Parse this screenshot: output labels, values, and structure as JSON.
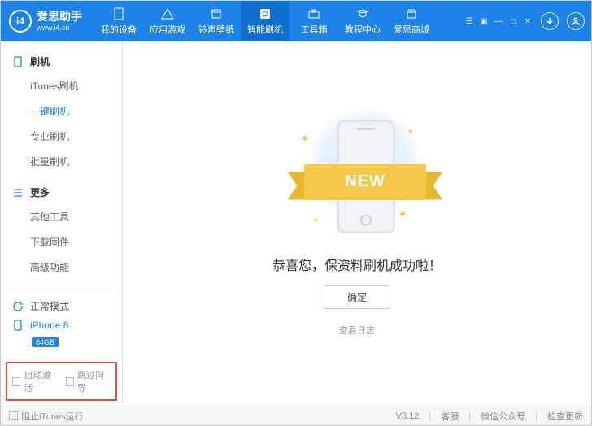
{
  "brand": {
    "logo_text": "i4",
    "title": "爱思助手",
    "url": "www.i4.cn"
  },
  "tabs": [
    {
      "label": "我的设备"
    },
    {
      "label": "应用游戏"
    },
    {
      "label": "铃声壁纸"
    },
    {
      "label": "智能刷机"
    },
    {
      "label": "工具箱"
    },
    {
      "label": "教程中心"
    },
    {
      "label": "爱思商城"
    }
  ],
  "sidebar": {
    "groups": [
      {
        "title": "刷机",
        "items": [
          "iTunes刷机",
          "一键刷机",
          "专业刷机",
          "批量刷机"
        ]
      },
      {
        "title": "更多",
        "items": [
          "其他工具",
          "下载固件",
          "高级功能"
        ]
      }
    ],
    "active_item": "一键刷机",
    "status": {
      "mode": "正常模式",
      "device": "iPhone 8",
      "storage": "64GB"
    },
    "checks": {
      "auto_activate": "自动激活",
      "skip_guide": "跳过向导"
    }
  },
  "content": {
    "ribbon": "NEW",
    "message": "恭喜您，保资料刷机成功啦！",
    "ok": "确定",
    "view_log": "查看日志"
  },
  "footer": {
    "block_itunes": "阻止iTunes运行",
    "version": "V8.12",
    "links": [
      "客服",
      "微信公众号",
      "检查更新"
    ]
  }
}
